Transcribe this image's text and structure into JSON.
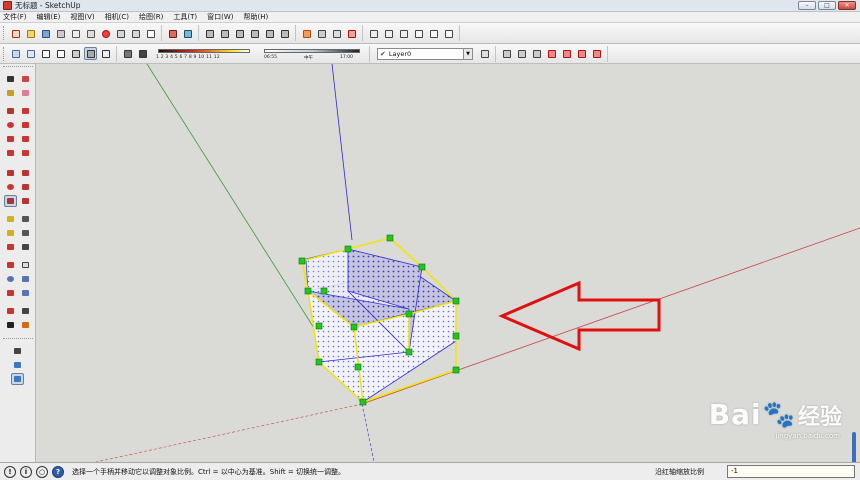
{
  "window": {
    "title": "无标题 - SketchUp",
    "minimize_label": "–",
    "maximize_label": "□",
    "close_label": "✕"
  },
  "menu": {
    "items": [
      {
        "label": "文件(F)"
      },
      {
        "label": "编辑(E)"
      },
      {
        "label": "视图(V)"
      },
      {
        "label": "相机(C)"
      },
      {
        "label": "绘图(R)"
      },
      {
        "label": "工具(T)"
      },
      {
        "label": "窗口(W)"
      },
      {
        "label": "帮助(H)"
      }
    ]
  },
  "toolbar": {
    "shadow_month_ticks": "1 2 3 4 5 6 7 8 9 10 11 12",
    "time_start": "06:55",
    "time_mid": "中午",
    "time_end": "17:00",
    "layer_name": "Layer0"
  },
  "status": {
    "hint": "选择一个手柄并移动它以调整对象比例。Ctrl = 以中心为基准。Shift = 切换统一调整。",
    "vcb_label": "沿红轴缩放比例",
    "vcb_value": "-1"
  },
  "watermark": {
    "brand": "Bai",
    "paw": "🐾",
    "suffix": "经验",
    "url": "jingyan.baidu.com"
  },
  "colors": {
    "axis_red": "#c84646",
    "axis_green": "#3a9a3a",
    "axis_blue": "#2a2ad8",
    "selection": "#f2e600",
    "handle": "#1fc81f",
    "arrow": "#e01010"
  }
}
